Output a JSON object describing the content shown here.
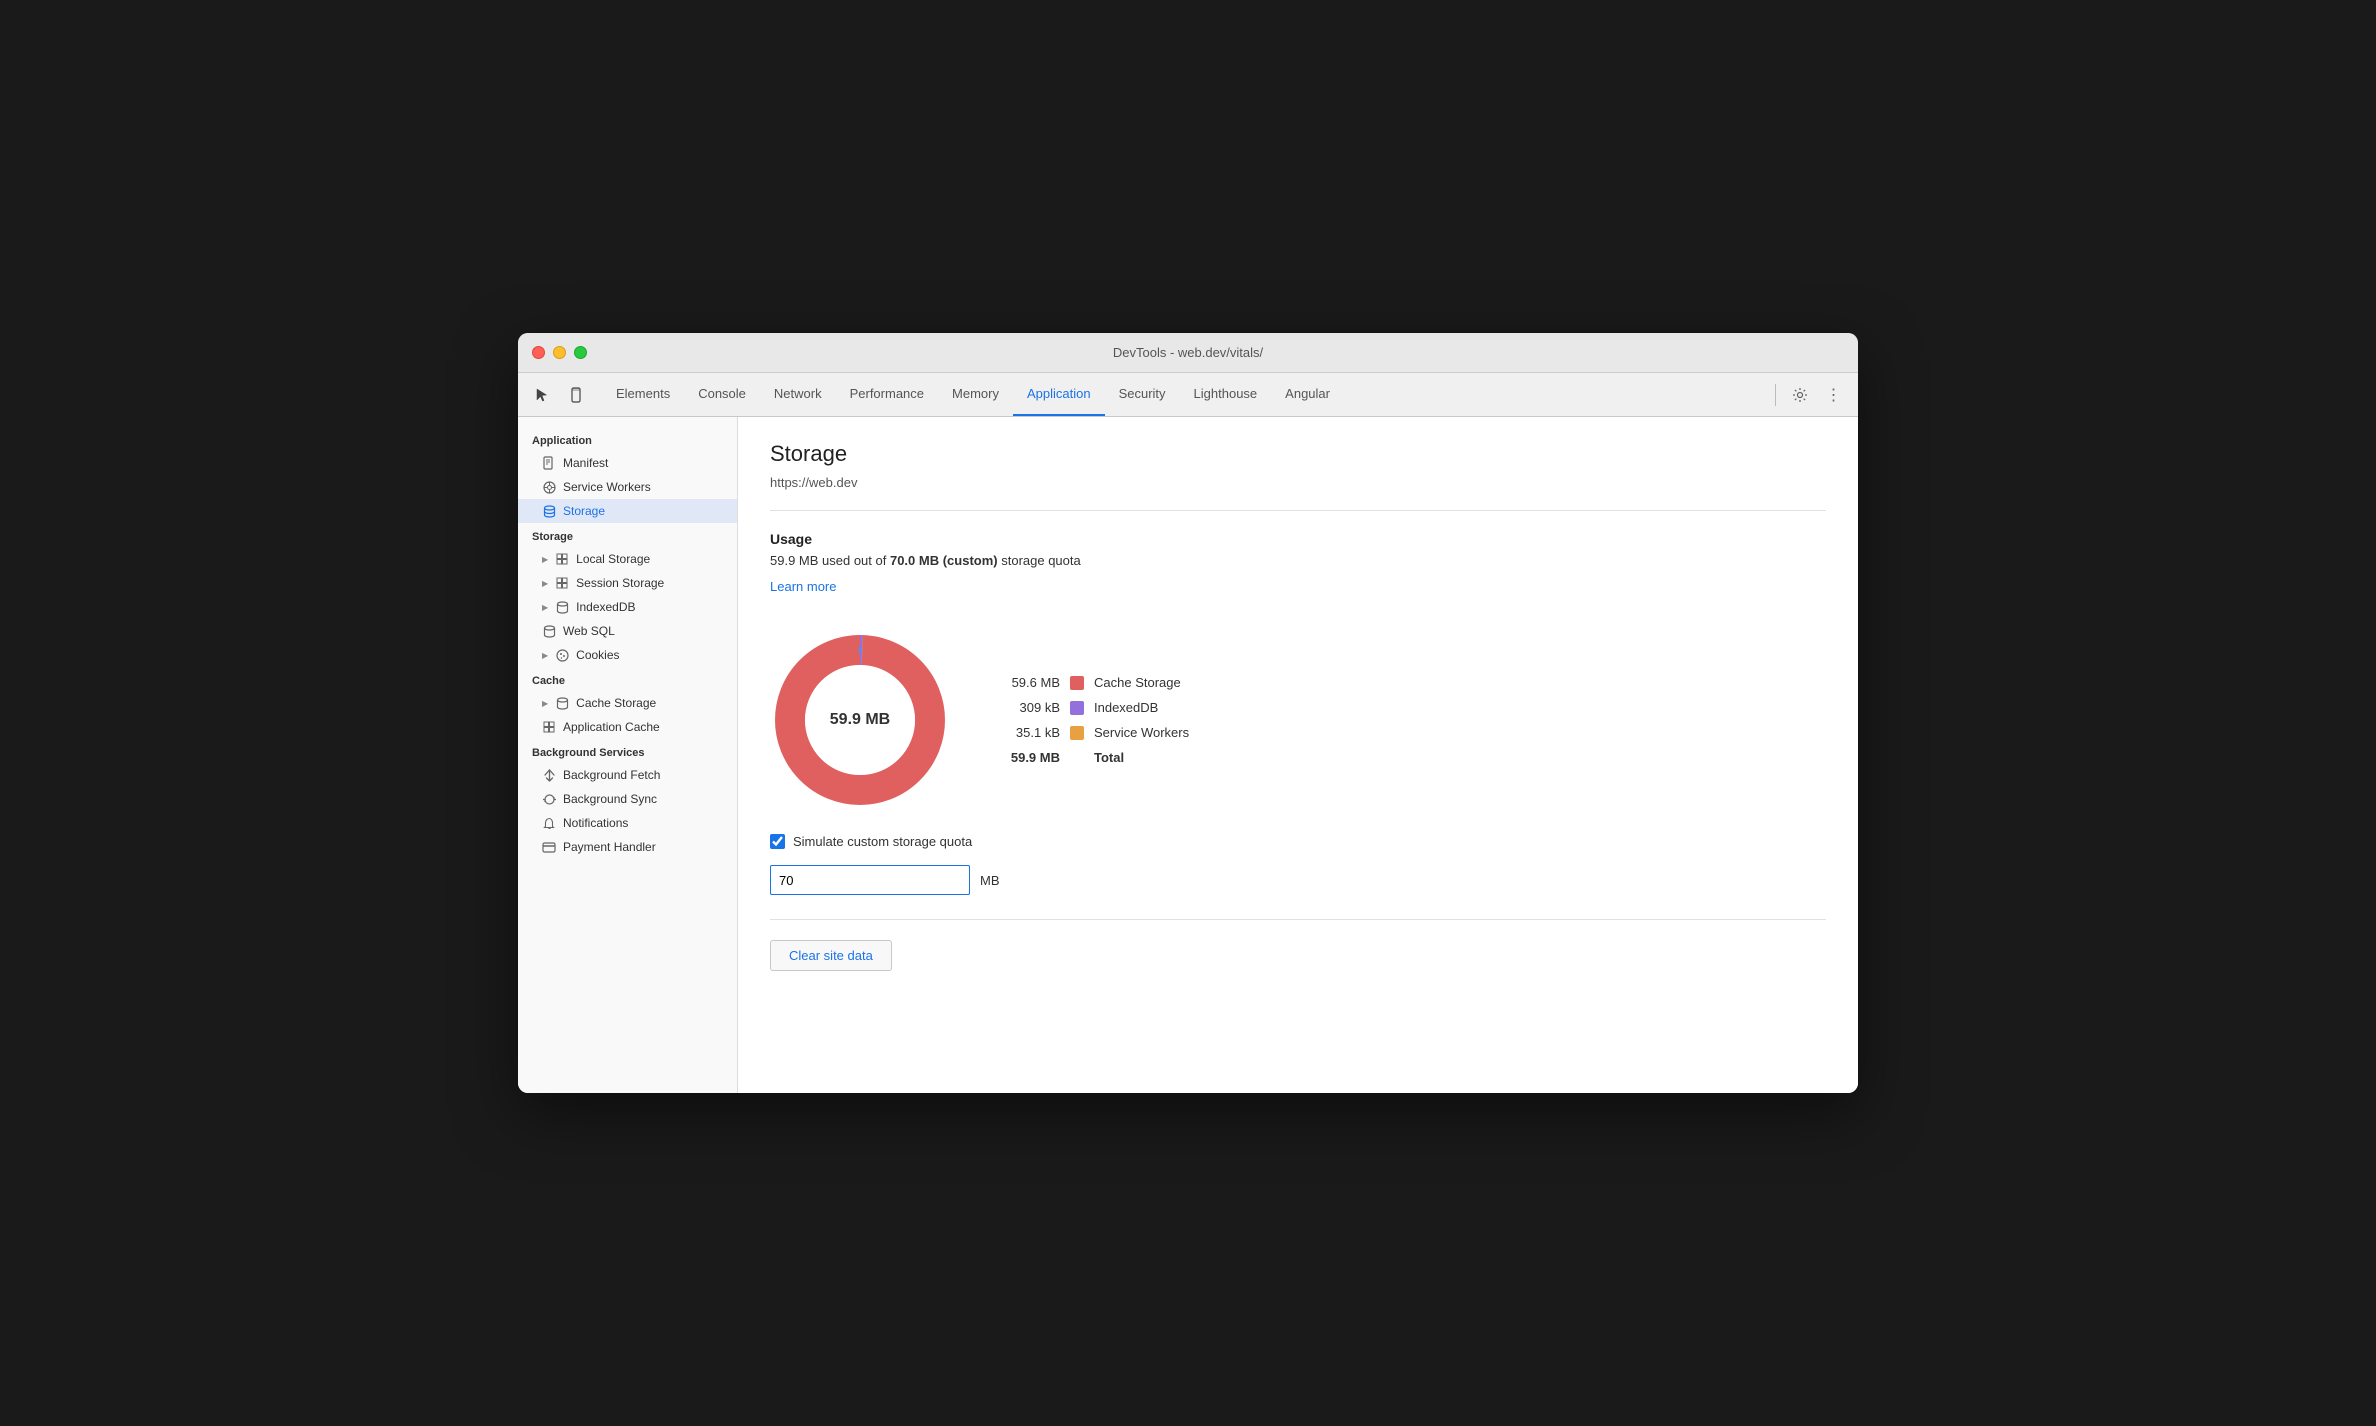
{
  "window": {
    "title": "DevTools - web.dev/vitals/"
  },
  "toolbar": {
    "cursor_icon": "⬡",
    "tabs": [
      {
        "label": "Elements",
        "active": false
      },
      {
        "label": "Console",
        "active": false
      },
      {
        "label": "Network",
        "active": false
      },
      {
        "label": "Performance",
        "active": false
      },
      {
        "label": "Memory",
        "active": false
      },
      {
        "label": "Application",
        "active": true
      },
      {
        "label": "Security",
        "active": false
      },
      {
        "label": "Lighthouse",
        "active": false
      },
      {
        "label": "Angular",
        "active": false
      }
    ]
  },
  "sidebar": {
    "application_label": "Application",
    "items_application": [
      {
        "label": "Manifest",
        "icon": "doc",
        "indent": 1
      },
      {
        "label": "Service Workers",
        "icon": "gear",
        "indent": 1
      },
      {
        "label": "Storage",
        "icon": "stack",
        "indent": 1,
        "active": true
      }
    ],
    "storage_label": "Storage",
    "items_storage": [
      {
        "label": "Local Storage",
        "icon": "grid",
        "indent": 1,
        "expandable": true
      },
      {
        "label": "Session Storage",
        "icon": "grid",
        "indent": 1,
        "expandable": true
      },
      {
        "label": "IndexedDB",
        "icon": "db",
        "indent": 1,
        "expandable": true
      },
      {
        "label": "Web SQL",
        "icon": "db",
        "indent": 1
      },
      {
        "label": "Cookies",
        "icon": "cookie",
        "indent": 1,
        "expandable": true
      }
    ],
    "cache_label": "Cache",
    "items_cache": [
      {
        "label": "Cache Storage",
        "icon": "db",
        "indent": 1,
        "expandable": true
      },
      {
        "label": "Application Cache",
        "icon": "grid",
        "indent": 1
      }
    ],
    "background_label": "Background Services",
    "items_background": [
      {
        "label": "Background Fetch",
        "icon": "fetch",
        "indent": 1
      },
      {
        "label": "Background Sync",
        "icon": "sync",
        "indent": 1
      },
      {
        "label": "Notifications",
        "icon": "bell",
        "indent": 1
      },
      {
        "label": "Payment Handler",
        "icon": "card",
        "indent": 1
      }
    ]
  },
  "content": {
    "title": "Storage",
    "url": "https://web.dev",
    "usage_title": "Usage",
    "usage_text_prefix": "59.9 MB used out of ",
    "usage_bold": "70.0 MB (custom)",
    "usage_text_suffix": " storage quota",
    "learn_more": "Learn more",
    "donut_label": "59.9 MB",
    "chart_total_used": 59.9,
    "chart_max": 70.0,
    "legend": [
      {
        "value": "59.6 MB",
        "color": "#e06060",
        "label": "Cache Storage",
        "bold": false
      },
      {
        "value": "309 kB",
        "color": "#9370db",
        "label": "IndexedDB",
        "bold": false
      },
      {
        "value": "35.1 kB",
        "color": "#e8a040",
        "label": "Service Workers",
        "bold": false
      },
      {
        "value": "59.9 MB",
        "color": null,
        "label": "Total",
        "bold": true
      }
    ],
    "checkbox_label": "Simulate custom storage quota",
    "checkbox_checked": true,
    "quota_value": "70",
    "quota_unit": "MB",
    "clear_button": "Clear site data"
  }
}
